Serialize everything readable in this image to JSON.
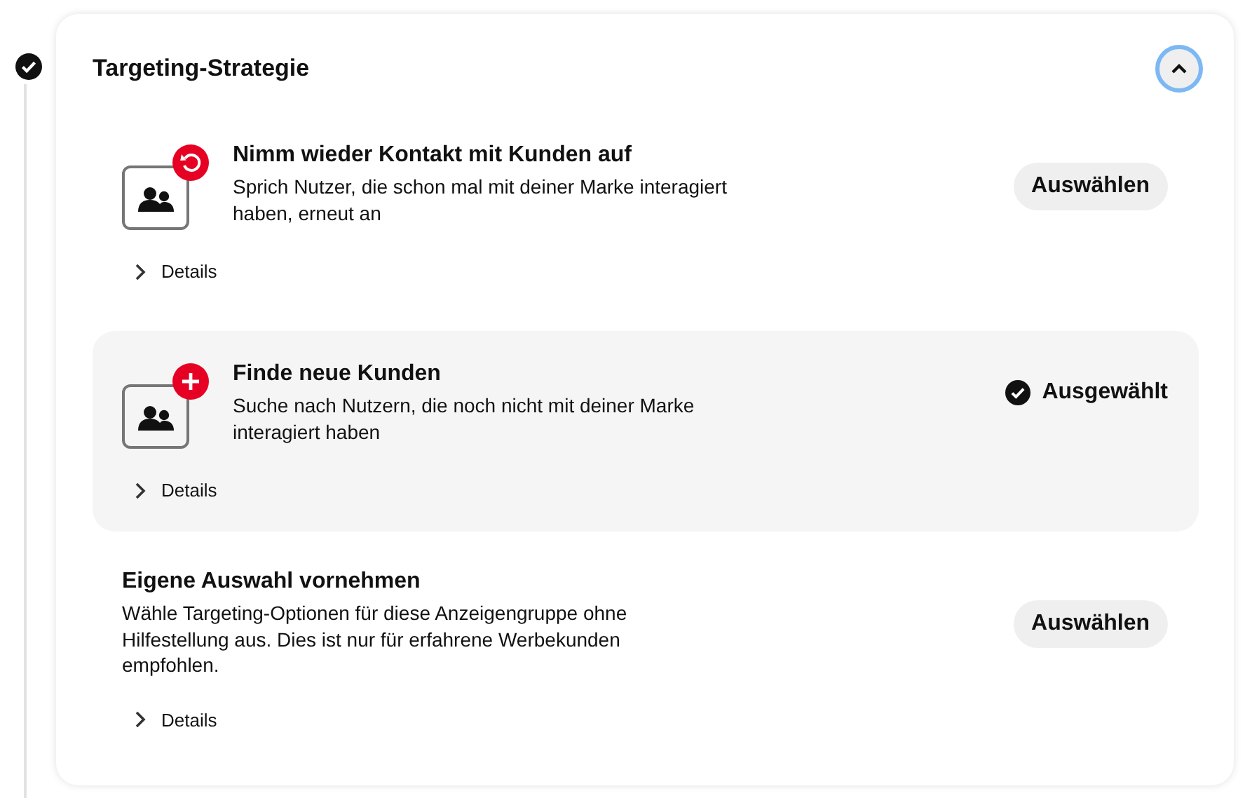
{
  "step": {
    "completed": true
  },
  "section": {
    "title": "Targeting-Strategie",
    "expanded": true,
    "options": [
      {
        "kind": "reconnect",
        "title": "Nimm wieder Kontakt mit Kunden auf",
        "description": "Sprich Nutzer, die schon mal mit deiner Marke interagiert haben, erneut an",
        "details": "Details",
        "action": "Auswählen",
        "selected": false
      },
      {
        "kind": "new",
        "title": "Finde neue Kunden",
        "description": "Suche nach Nutzern, die noch nicht mit deiner Marke interagiert haben",
        "details": "Details",
        "action": "Ausgewählt",
        "selected": true
      },
      {
        "kind": "custom",
        "title": "Eigene Auswahl vornehmen",
        "description": "Wähle Targeting-Optionen für diese Anzeigengruppe ohne Hilfestellung aus. Dies ist nur für erfahrene Werbekunden empfohlen.",
        "details": "Details",
        "action": "Auswählen",
        "selected": false
      }
    ]
  }
}
